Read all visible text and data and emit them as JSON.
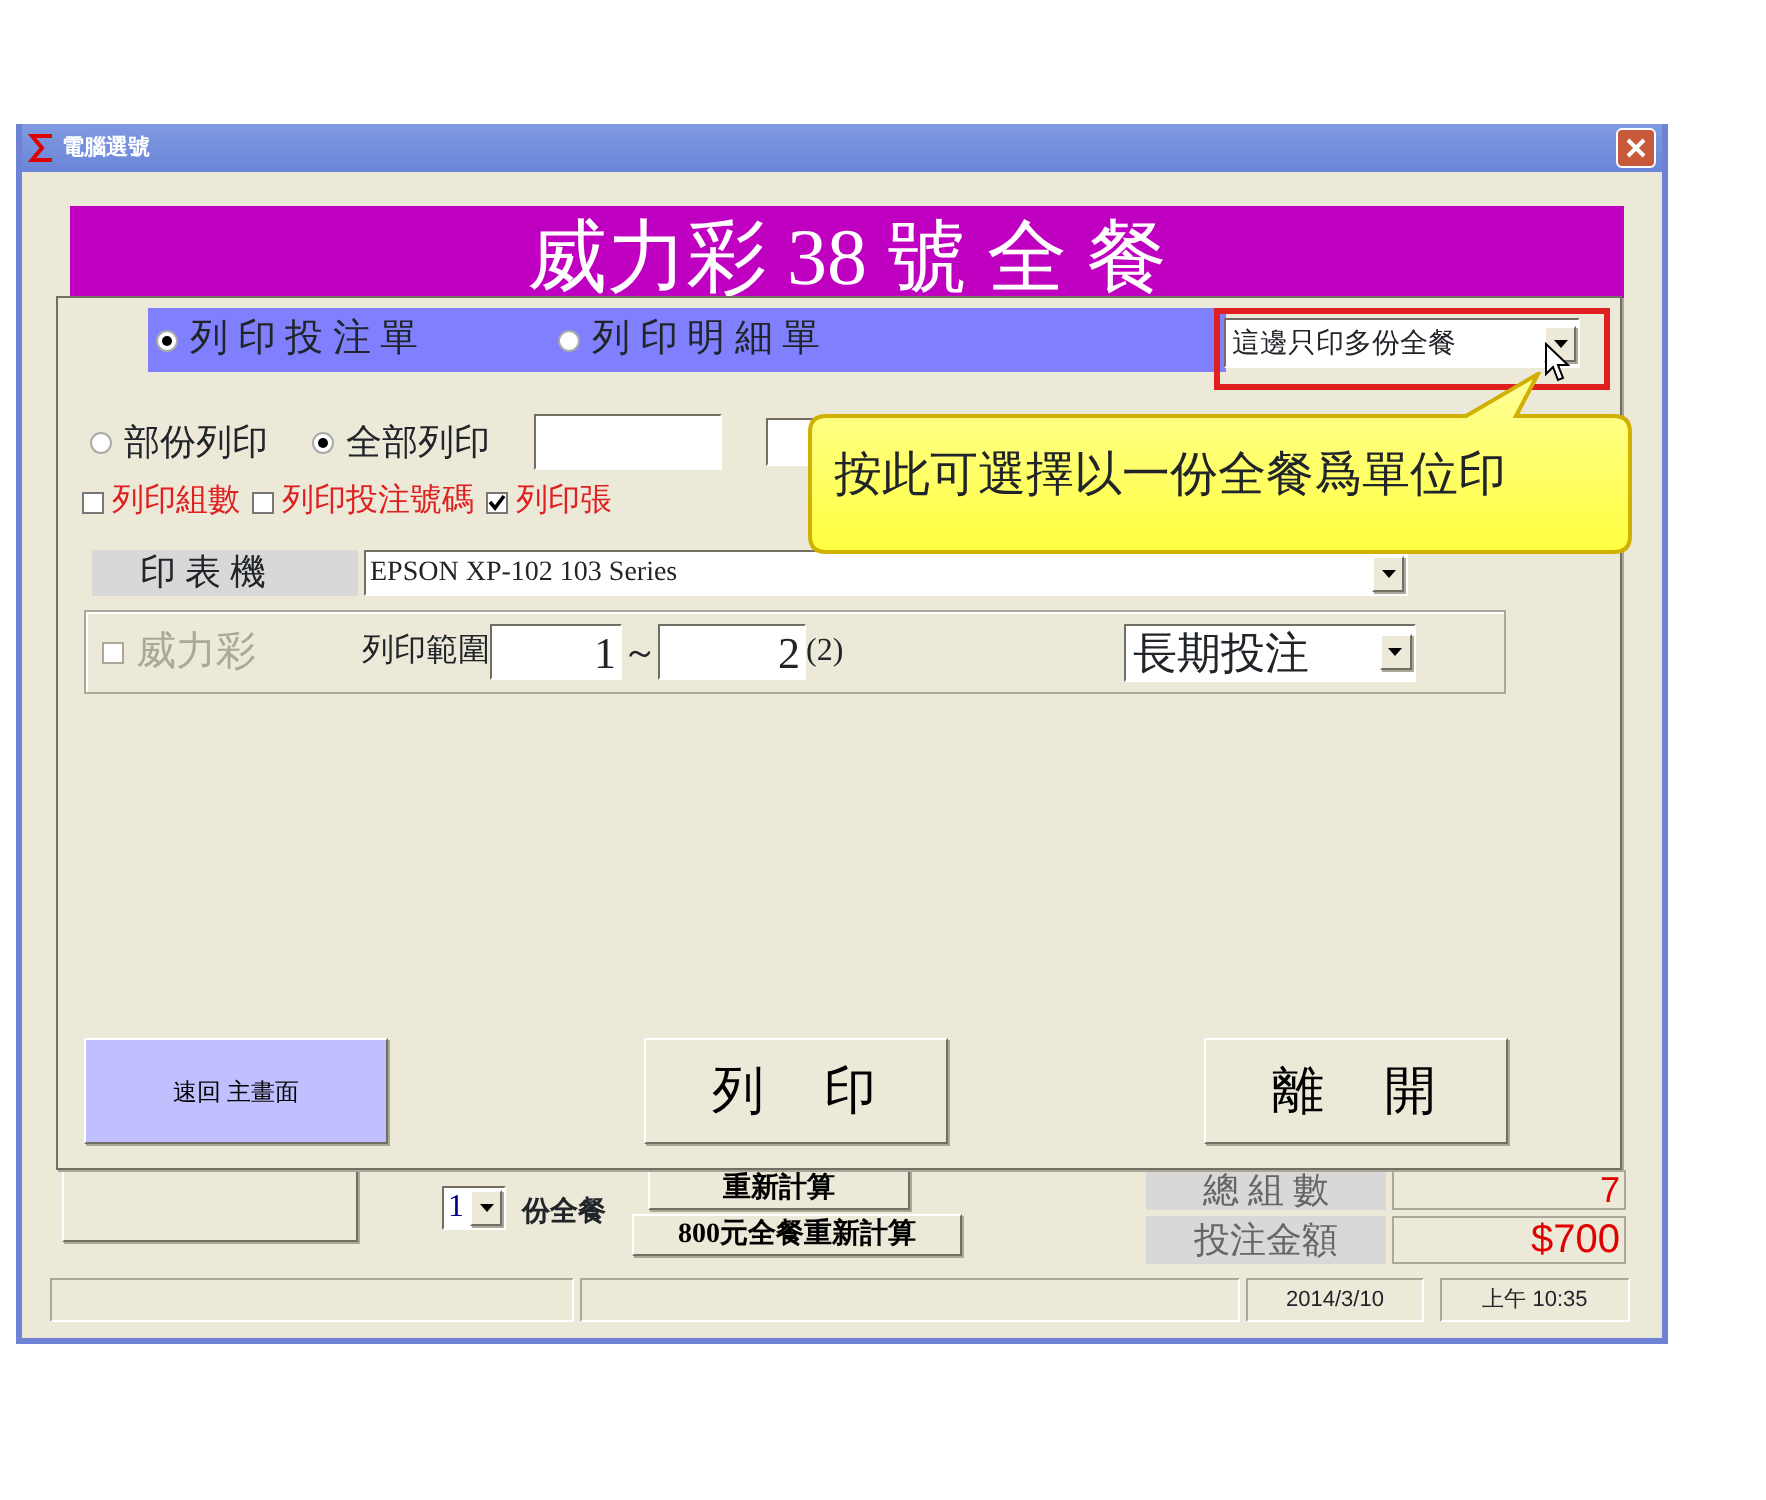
{
  "window": {
    "title": "電腦選號"
  },
  "banner": {
    "title": "威力彩 38 號 全 餐"
  },
  "print_dialog": {
    "mode_options": [
      {
        "label": "列 印 投 注 單",
        "selected": true
      },
      {
        "label": "列 印 明 細 單",
        "selected": false
      }
    ],
    "copy_dropdown": {
      "value": "這邊只印多份全餐",
      "highlighted": true
    },
    "range_options": [
      {
        "label": "部份列印",
        "selected": false
      },
      {
        "label": "全部列印",
        "selected": true
      }
    ],
    "print_options": [
      {
        "label": "列印組數",
        "checked": false
      },
      {
        "label": "列印投注號碼",
        "checked": false
      },
      {
        "label": "列印張",
        "checked": true
      }
    ],
    "printer": {
      "label": "印 表 機",
      "value": "EPSON XP-102 103 Series"
    },
    "game": {
      "label": "威力彩",
      "checked": false,
      "disabled": true
    },
    "range": {
      "label": "列印範圍",
      "from": "1",
      "separator": "～",
      "to": "2",
      "count": "(2)"
    },
    "term_dropdown": {
      "value": "長期投注"
    },
    "buttons": [
      {
        "label": "速回 主畫面",
        "kind": "home"
      },
      {
        "label": "列　印",
        "kind": "plain"
      },
      {
        "label": "離　開",
        "kind": "plain"
      }
    ]
  },
  "tooltip": {
    "text": "按此可選擇以一份全餐爲單位印"
  },
  "bottom": {
    "sets_dropdown": {
      "value": "1"
    },
    "sets_label": "份全餐",
    "recalc_buttons": [
      "重新計算",
      "800元全餐重新計算"
    ],
    "totals": [
      {
        "label": "總 組 數",
        "value": "7"
      },
      {
        "label": "投注金額",
        "value": "$700"
      }
    ]
  },
  "status_bar": [
    "2014/3/10",
    "上午 10:35"
  ]
}
